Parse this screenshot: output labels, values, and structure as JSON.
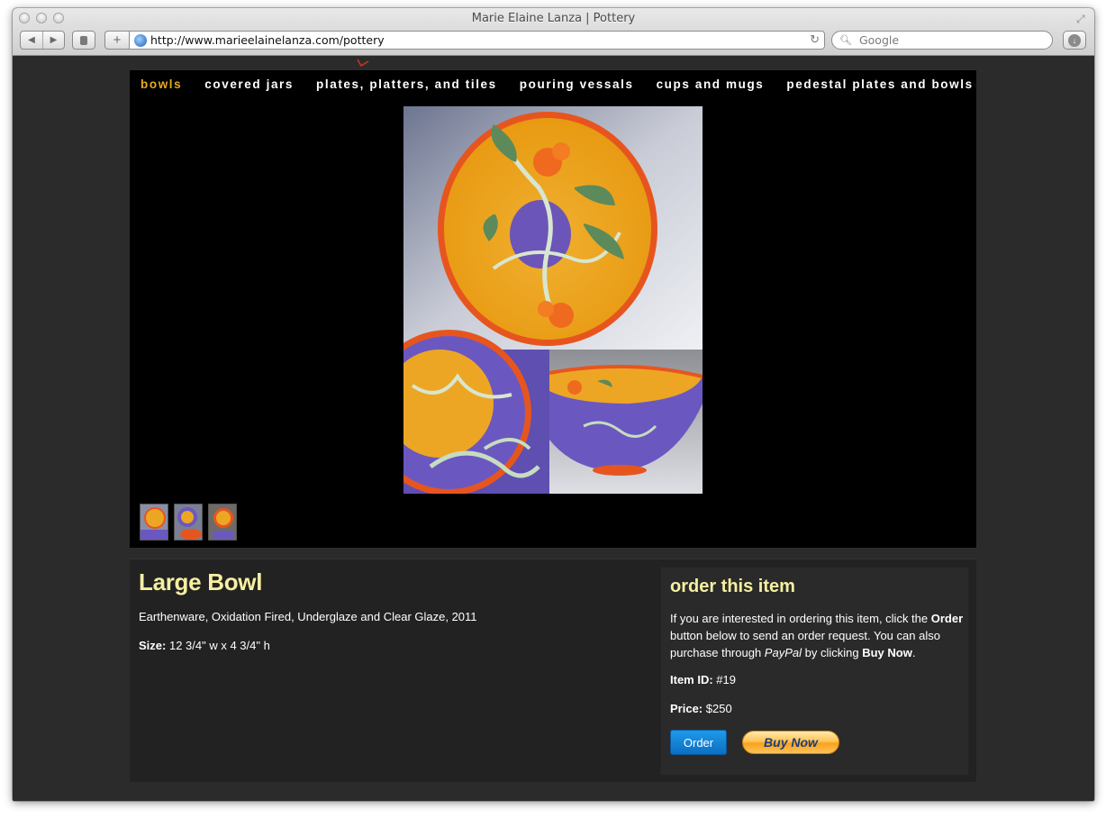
{
  "browser": {
    "window_title": "Marie Elaine Lanza | Pottery",
    "url": "http://www.marieelainelanza.com/pottery",
    "search_placeholder": "Google"
  },
  "nav": {
    "items": [
      {
        "label": "bowls",
        "active": true
      },
      {
        "label": "covered jars",
        "active": false
      },
      {
        "label": "plates, platters, and tiles",
        "active": false
      },
      {
        "label": "pouring vessals",
        "active": false
      },
      {
        "label": "cups and mugs",
        "active": false
      },
      {
        "label": "pedestal plates and bowls",
        "active": false
      }
    ]
  },
  "gallery": {
    "thumbnail_count": 3
  },
  "item": {
    "title": "Large Bowl",
    "description": "Earthenware, Oxidation Fired, Underglaze and Clear Glaze, 2011",
    "size_label": "Size:",
    "size_value": "12 3/4\" w x 4 3/4\" h"
  },
  "order": {
    "title": "order this item",
    "text_1": "If you are interested in ordering this item, click the ",
    "text_order": "Order",
    "text_2": " button below to send an order request. You can also purchase through ",
    "text_paypal": "PayPal",
    "text_3": " by clicking ",
    "text_buynow": "Buy Now",
    "text_4": ".",
    "item_id_label": "Item ID:",
    "item_id_value": "#19",
    "price_label": "Price:",
    "price_value": "$250",
    "order_button": "Order",
    "buynow_button": "Buy Now"
  },
  "colors": {
    "accent_yellow": "#f6efa1",
    "active_nav": "#e9a91e",
    "page_bg": "#2b2b2b",
    "gallery_bg": "#000000"
  }
}
